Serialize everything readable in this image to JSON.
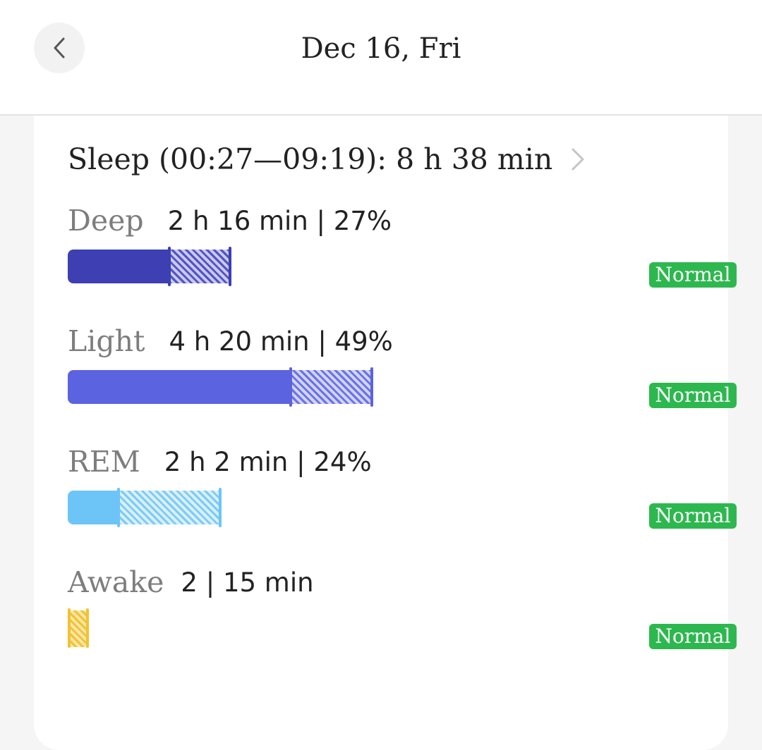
{
  "header": {
    "title": "Dec 16, Fri"
  },
  "summary": {
    "label": "Sleep (00:27—09:19):  8 h 38 min"
  },
  "stages": [
    {
      "name": "Deep",
      "value": "2 h 16 min | 27%",
      "badge": "Normal",
      "color": "#3d3fb2",
      "hatch_color": "#5253c4"
    },
    {
      "name": "Light",
      "value": "4 h 20 min | 49%",
      "badge": "Normal",
      "color": "#5b63e0",
      "hatch_color": "#6a72e6"
    },
    {
      "name": "REM",
      "value": "2 h 2 min | 24%",
      "badge": "Normal",
      "color": "#6cc4f7",
      "hatch_color": "#7ccbf7"
    },
    {
      "name": "Awake",
      "value": "2 |  15 min",
      "badge": "Normal",
      "color": "#f2c233",
      "hatch_color": "#f2c233"
    }
  ],
  "colors": {
    "badge": "#2db84f",
    "accent_text": "#222222",
    "muted_text": "#7d7d7d"
  },
  "icons": {
    "back": "chevron-left-icon",
    "summary_more": "chevron-right-icon"
  }
}
